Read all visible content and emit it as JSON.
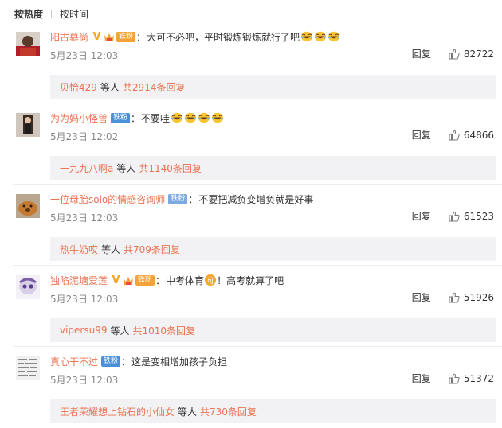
{
  "sort": {
    "hot_label": "按热度",
    "time_label": "按时间"
  },
  "comments": [
    {
      "username": "阳古慕尚",
      "badge": "铁粉",
      "text": "大可不必吧，平时锻炼锻炼就行了吧",
      "date": "5月23日 12:03",
      "reply_label": "回复",
      "likes": "82722",
      "reply_user": "贝怡429",
      "reply_etc": "等人",
      "reply_total": "共2914条回复"
    },
    {
      "username": "为为妈小怪兽",
      "badge": "铁粉",
      "text": "不要哇",
      "date": "5月23日 12:02",
      "reply_label": "回复",
      "likes": "64866",
      "reply_user": "一九九八啊a",
      "reply_etc": "等人",
      "reply_total": "共1140条回复"
    },
    {
      "username": "一位母胎solo的情感咨询师",
      "badge": "铁粉",
      "text": "不要把减负变增负就是好事",
      "date": "5月23日 12:03",
      "reply_label": "回复",
      "likes": "61523",
      "reply_user": "热牛奶哎",
      "reply_etc": "等人",
      "reply_total": "共709条回复"
    },
    {
      "username": "独陷泥塘爱莲",
      "badge": "铁粉",
      "text_before": "中考体育",
      "coin_glyph": "可",
      "text_after": "！高考就算了吧",
      "date": "5月23日 12:03",
      "reply_label": "回复",
      "likes": "51926",
      "reply_user": "vipersu99",
      "reply_etc": "等人",
      "reply_total": "共1010条回复"
    },
    {
      "username": "真心干不过",
      "badge": "铁粉",
      "text": "这是变相增加孩子负担",
      "date": "5月23日 12:03",
      "reply_label": "回复",
      "likes": "51372",
      "reply_user": "王者荣耀想上钻石的小仙女",
      "reply_etc": "等人",
      "reply_total": "共730条回复"
    }
  ],
  "colors": {
    "accent": "#eb7350",
    "badge_blue": "#4a90d9",
    "vip_gold": "#f5a623",
    "reply_bg": "#f2f2f5"
  },
  "icons": [
    "v-verified-icon",
    "crown-icon",
    "laughing-emoji-icon",
    "like-thumb-icon",
    "coin-emoji-icon"
  ]
}
